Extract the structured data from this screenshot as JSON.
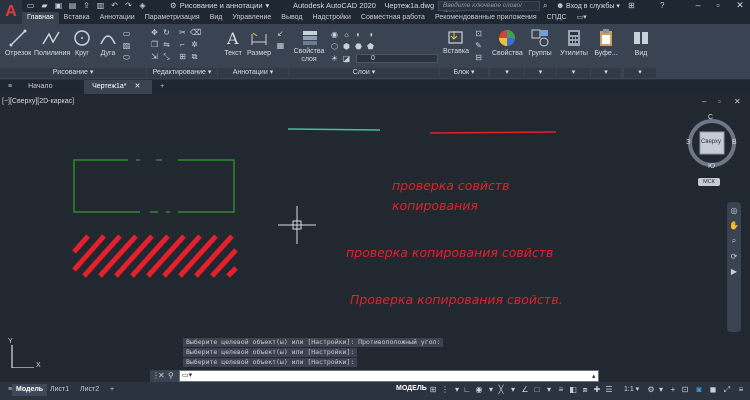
{
  "app": {
    "title": "Autodesk AutoCAD 2020",
    "file": "Чертеж1a.dwg",
    "logo_letter": "A",
    "workspace": "Рисование и аннотации",
    "search_placeholder": "Введите ключевое слово/фразу",
    "login": "Вход в службы"
  },
  "ribbon_tabs": [
    "Главная",
    "Вставка",
    "Аннотации",
    "Параметризация",
    "Вид",
    "Управление",
    "Вывод",
    "Надстройки",
    "Совместная работа",
    "Рекомендованные приложения",
    "СПДС"
  ],
  "ribbon": {
    "draw": {
      "line": "Отрезок",
      "polyline": "Полилиния",
      "circle": "Круг",
      "arc": "Дуга",
      "panel": "Рисование"
    },
    "modify": {
      "panel": "Редактирование"
    },
    "annotation": {
      "text": "Текст",
      "dimension": "Размер",
      "panel": "Аннотации"
    },
    "layers": {
      "properties": "Свойства слоя",
      "current_layer": "0",
      "panel": "Слои"
    },
    "block": {
      "insert": "Вставка",
      "panel": "Блок"
    },
    "properties": "Свойства",
    "groups": "Группы",
    "utilities": "Утилиты",
    "clipboard": "Буфе...",
    "view": "Вид"
  },
  "doc_tabs": {
    "start": "Начало",
    "drawing": "Чертеж1a*",
    "add": "+"
  },
  "viewport_label": "[−][Сверху][2D-каркас]",
  "viewcube": {
    "north": "С",
    "south": "Ю",
    "east": "В",
    "west": "З",
    "face": "Сверху",
    "ucs": "МСК"
  },
  "canvas_texts": [
    {
      "text": "проверка совйств\nкопирования"
    },
    {
      "text": "проверка копирования совйств"
    },
    {
      "text": "Проверка копирования свойств."
    }
  ],
  "command_history": [
    "Выберите целевой объект(ы) или [Настройки]: Противоположный угол:",
    "Выберите целевой объект(ы) или [Настройки]:",
    "Выберите целевой объект(ы) или [Настройки]:"
  ],
  "ucs_labels": {
    "x": "X",
    "y": "Y"
  },
  "layout_tabs": {
    "model": "Модель",
    "sheet1": "Лист1",
    "sheet2": "Лист2",
    "add": "+"
  },
  "status": {
    "model": "МОДЕЛЬ",
    "scale": "1:1"
  },
  "colors": {
    "accent": "#e03a3a",
    "red_text": "#e5202a",
    "green": "#2a8a2a",
    "cyan_line": "#3fbfa0"
  }
}
